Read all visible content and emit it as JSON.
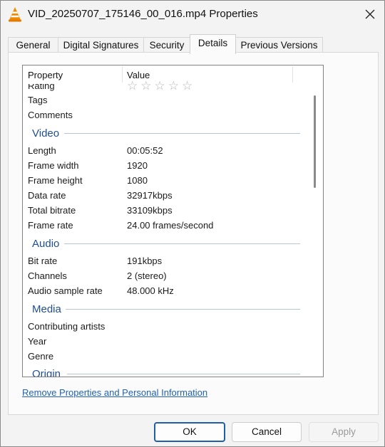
{
  "window": {
    "title": "VID_20250707_175146_00_016.mp4 Properties"
  },
  "tabs": [
    {
      "label": "General"
    },
    {
      "label": "Digital Signatures"
    },
    {
      "label": "Security"
    },
    {
      "label": "Details",
      "active": true
    },
    {
      "label": "Previous Versions"
    }
  ],
  "details": {
    "header": {
      "property": "Property",
      "value": "Value"
    },
    "top_rows": [
      {
        "label": "Rating",
        "value": ""
      },
      {
        "label": "Tags",
        "value": ""
      },
      {
        "label": "Comments",
        "value": ""
      }
    ],
    "rating_stars": [
      "☆",
      "☆",
      "☆",
      "☆",
      "☆"
    ],
    "sections": [
      {
        "title": "Video",
        "rows": [
          {
            "label": "Length",
            "value": "00:05:52"
          },
          {
            "label": "Frame width",
            "value": "1920"
          },
          {
            "label": "Frame height",
            "value": "1080"
          },
          {
            "label": "Data rate",
            "value": "32917kbps"
          },
          {
            "label": "Total bitrate",
            "value": "33109kbps"
          },
          {
            "label": "Frame rate",
            "value": "24.00 frames/second"
          }
        ]
      },
      {
        "title": "Audio",
        "rows": [
          {
            "label": "Bit rate",
            "value": "191kbps"
          },
          {
            "label": "Channels",
            "value": "2 (stereo)"
          },
          {
            "label": "Audio sample rate",
            "value": "48.000 kHz"
          }
        ]
      },
      {
        "title": "Media",
        "rows": [
          {
            "label": "Contributing artists",
            "value": ""
          },
          {
            "label": "Year",
            "value": ""
          },
          {
            "label": "Genre",
            "value": ""
          }
        ]
      },
      {
        "title": "Origin",
        "rows": []
      }
    ]
  },
  "link": {
    "label": "Remove Properties and Personal Information"
  },
  "buttons": {
    "ok": "OK",
    "cancel": "Cancel",
    "apply": "Apply"
  },
  "colors": {
    "accent": "#1f5fa8",
    "section": "#1f4e94",
    "link": "#2262b4"
  }
}
